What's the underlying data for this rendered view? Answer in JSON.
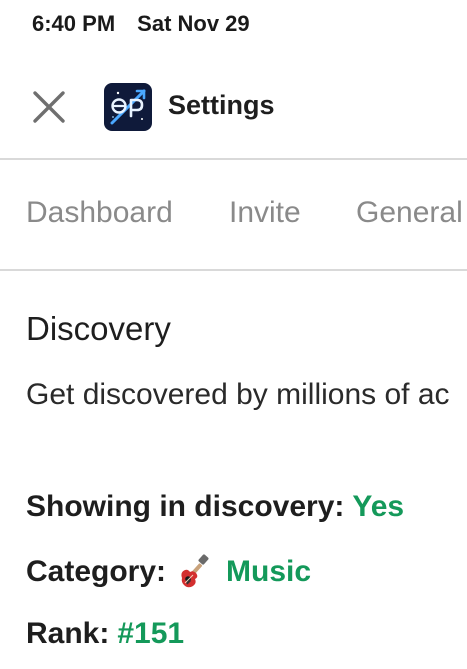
{
  "status_bar": {
    "time": "6:40 PM",
    "date": "Sat Nov 29"
  },
  "header": {
    "title": "Settings",
    "close_icon": "close-icon",
    "logo_icon": "app-logo"
  },
  "tabs": [
    {
      "label": "Dashboard"
    },
    {
      "label": "Invite"
    },
    {
      "label": "General"
    }
  ],
  "discovery": {
    "title": "Discovery",
    "description": "Get discovered by millions of ac",
    "showing_label": "Showing in discovery:",
    "showing_value": "Yes",
    "category_label": "Category:",
    "category_icon": "guitar-icon",
    "category_value": "Music",
    "rank_label": "Rank:",
    "rank_value": "#151"
  },
  "colors": {
    "accent_green": "#14995a",
    "tab_inactive": "#8a8a8a",
    "divider": "#d9d9d9",
    "logo_bg": "#0f1a3a"
  }
}
